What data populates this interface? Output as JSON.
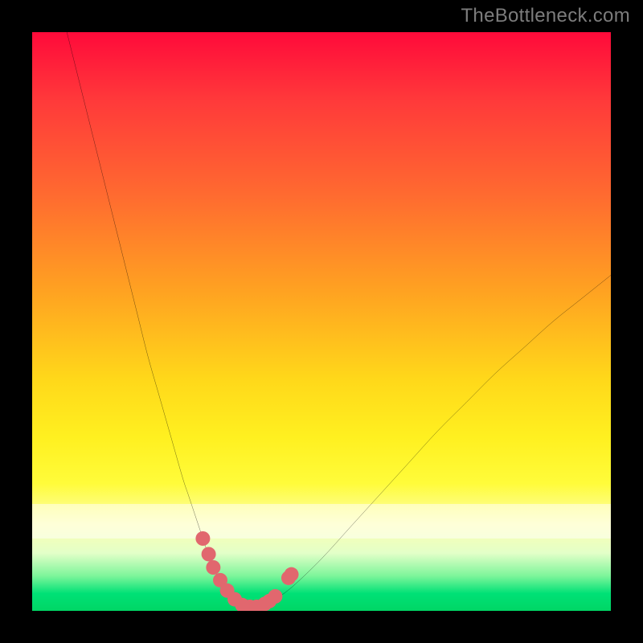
{
  "watermark": "TheBottleneck.com",
  "colors": {
    "background": "#000000",
    "gradient_top": "#ff0a3a",
    "gradient_bottom": "#00d665",
    "curve_stroke": "#000000",
    "marker_fill": "#e1676e",
    "marker_stroke": "#e1676e"
  },
  "chart_data": {
    "type": "line",
    "title": "",
    "xlabel": "",
    "ylabel": "",
    "xlim": [
      0,
      100
    ],
    "ylim": [
      0,
      100
    ],
    "series": [
      {
        "name": "bottleneck-curve",
        "x": [
          6,
          8,
          10,
          12,
          14,
          16,
          18,
          20,
          22,
          24,
          26,
          27,
          28,
          29,
          30,
          31,
          32,
          33,
          34,
          35,
          36,
          37,
          38,
          39,
          40,
          42,
          45,
          50,
          55,
          60,
          65,
          70,
          75,
          80,
          85,
          90,
          95,
          100
        ],
        "y": [
          100,
          92,
          84,
          76,
          68,
          60,
          52,
          44,
          37,
          30,
          23,
          20,
          17,
          14,
          11,
          8.5,
          6,
          4,
          2.6,
          1.6,
          1.0,
          0.7,
          0.6,
          0.7,
          1.0,
          2.0,
          4.2,
          9,
          14.5,
          20,
          25.5,
          31,
          36,
          41,
          45.5,
          50,
          54,
          58
        ]
      }
    ],
    "markers": {
      "name": "highlighted-points",
      "x": [
        29.5,
        30.5,
        31.3,
        32.5,
        33.7,
        35.0,
        36.3,
        37.6,
        38.8,
        40.2,
        41.0,
        42.0,
        44.3,
        44.8
      ],
      "y": [
        12.5,
        9.8,
        7.5,
        5.3,
        3.5,
        2.0,
        1.0,
        0.7,
        0.7,
        1.2,
        1.7,
        2.5,
        5.7,
        6.3
      ]
    }
  }
}
